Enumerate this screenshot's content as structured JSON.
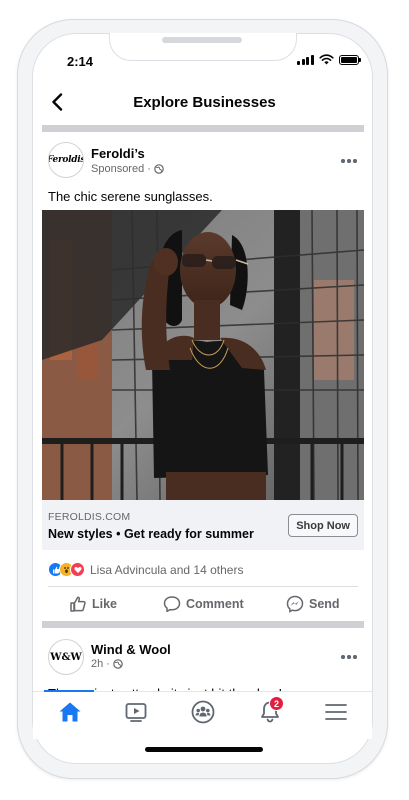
{
  "status_bar": {
    "time": "2:14"
  },
  "header": {
    "title": "Explore Businesses"
  },
  "post1": {
    "avatar_text": "Feroldis",
    "page_name": "Feroldi’s",
    "meta": "Sponsored ·",
    "text": "The chic serene sunglasses.",
    "link": {
      "domain": "FEROLDIS.COM",
      "title": "New styles • Get ready for summer",
      "cta": "Shop Now"
    },
    "reactions_text": "Lisa Advincula and 14 others",
    "actions": {
      "like": "Like",
      "comment": "Comment",
      "send": "Send"
    }
  },
  "post2": {
    "avatar_text": "W&W",
    "page_name": "Wind & Wool",
    "meta": "2h ·",
    "text": "The coziest cotton knits just hit the shop!"
  },
  "tab_bar": {
    "tabs": [
      "home-icon",
      "video-icon",
      "groups-icon",
      "notifications-icon",
      "menu-icon"
    ],
    "active": "home-icon",
    "notifications_badge": "2"
  },
  "colors": {
    "accent": "#1877f2",
    "badge": "#e41e3f",
    "secondary_text": "#65676b"
  }
}
